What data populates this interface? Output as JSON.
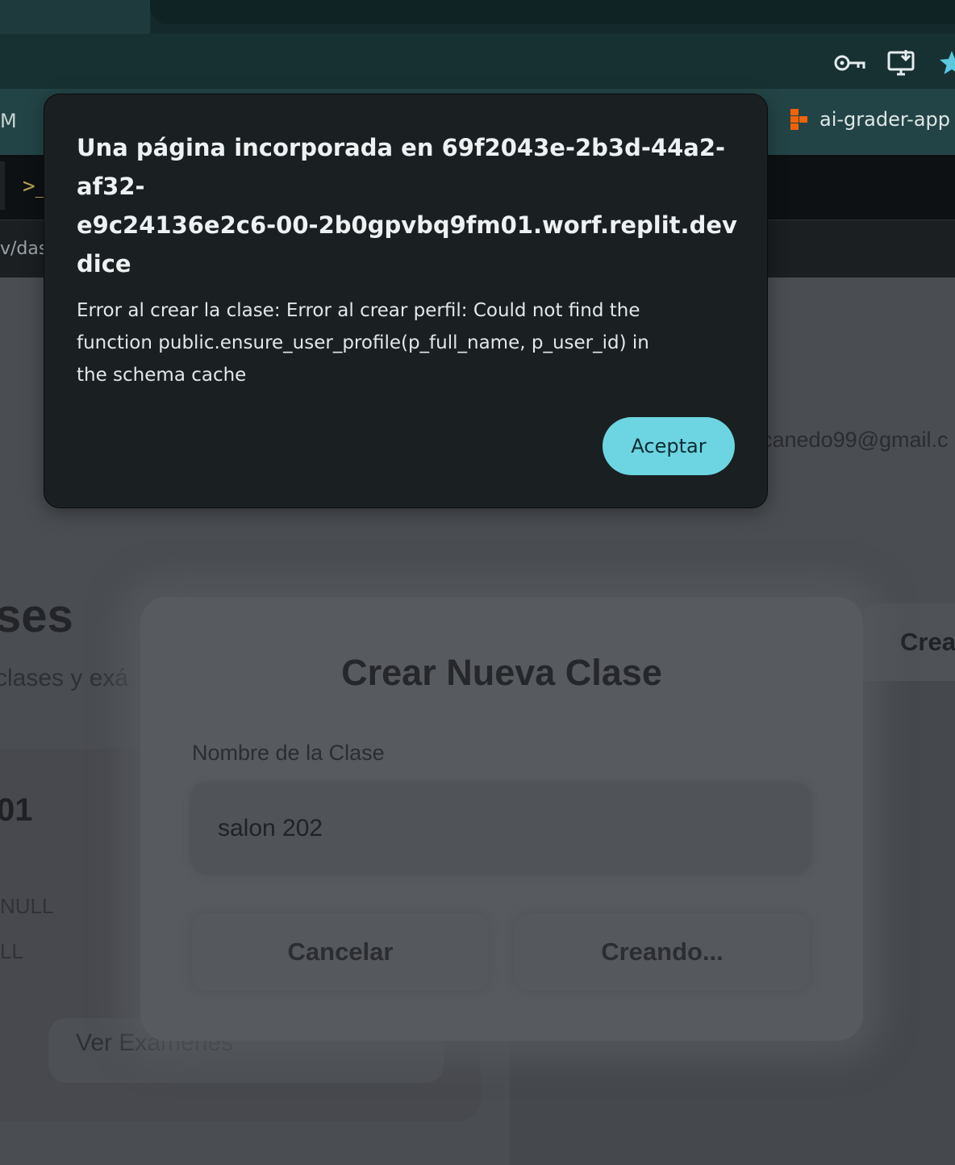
{
  "browser": {
    "bookmark_left_fragment": "M",
    "bookmark_item": "ai-grader-app",
    "icons": [
      "key-icon",
      "install-app-icon",
      "bookmark-star-icon"
    ]
  },
  "replit": {
    "prompt_glyph": ">_",
    "url_fragment": "v/das"
  },
  "app": {
    "email_fragment": "canedo99@gmail.c",
    "page_heading_fragment": "ses",
    "page_subtitle_fragment": "clases y exá",
    "class_card": {
      "name_fragment": "01",
      "line1": "NULL",
      "line2": "LL",
      "view_exams_label": "Ver Exámenes"
    },
    "create_button_fragment": "Crea"
  },
  "modal": {
    "title": "Crear Nueva Clase",
    "field_label": "Nombre de la Clase",
    "field_value": "salon 202",
    "cancel_label": "Cancelar",
    "create_label": "Creando..."
  },
  "dialog": {
    "title_lines": [
      "Una página incorporada en 69f2043e-2b3d-44a2-",
      "af32-",
      "e9c24136e2c6-00-2b0gpvbq9fm01.worf.replit.dev",
      "dice"
    ],
    "message_lines": [
      "Error al crear la clase: Error al crear perfil: Could not find the",
      "function public.ensure_user_profile(p_full_name, p_user_id) in",
      "the schema cache"
    ],
    "accept_label": "Aceptar"
  },
  "colors": {
    "accept_button": "#6dd5e1",
    "dialog_bg": "#1a1f22",
    "replit_orange": "#f26207"
  }
}
